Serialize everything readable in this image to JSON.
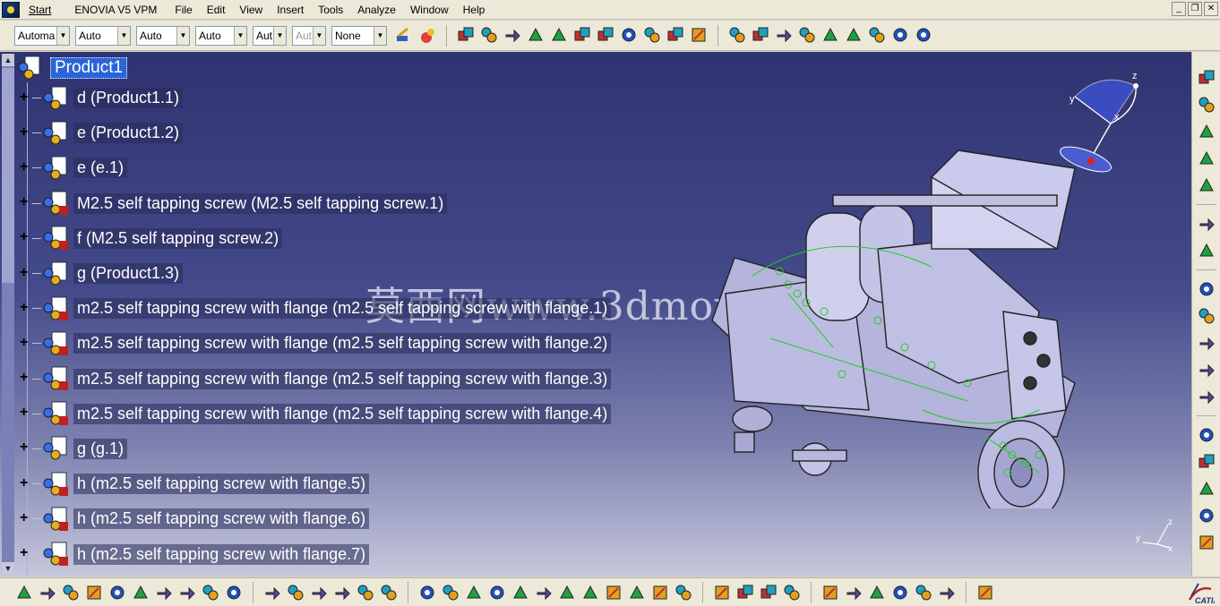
{
  "menubar": {
    "start": "Start",
    "enovia": "ENOVIA V5 VPM",
    "items": [
      "File",
      "Edit",
      "View",
      "Insert",
      "Tools",
      "Analyze",
      "Window",
      "Help"
    ]
  },
  "toolbar": {
    "combos": [
      {
        "value": "Automa",
        "disabled": false,
        "w": 60
      },
      {
        "value": "Auto",
        "disabled": false,
        "w": 62
      },
      {
        "value": "Auto",
        "disabled": false,
        "w": 60
      },
      {
        "value": "Auto",
        "disabled": false,
        "w": 58
      },
      {
        "value": "Aut",
        "disabled": false,
        "w": 38
      },
      {
        "value": "Aut",
        "disabled": true,
        "w": 38
      },
      {
        "value": "None",
        "disabled": false,
        "w": 62
      }
    ]
  },
  "tree": {
    "root": "Product1",
    "nodes": [
      "d (Product1.1)",
      "e (Product1.2)",
      "e (e.1)",
      "M2.5  self tapping screw (M2.5  self tapping screw.1)",
      "f (M2.5  self tapping screw.2)",
      "g (Product1.3)",
      "m2.5 self tapping screw with flange (m2.5 self tapping screw with flange.1)",
      "m2.5 self tapping screw with flange (m2.5 self tapping screw with flange.2)",
      "m2.5 self tapping screw with flange (m2.5 self tapping screw with flange.3)",
      "m2.5 self tapping screw with flange (m2.5 self tapping screw with flange.4)",
      "g (g.1)",
      "h (m2.5 self tapping screw with flange.5)",
      "h (m2.5 self tapping screw with flange.6)",
      "h (m2.5 self tapping screw with flange.7)"
    ]
  },
  "watermark": "莫西网www.3dmox.com",
  "compass": {
    "x": "x",
    "y": "y",
    "z": "z"
  },
  "axis": {
    "x": "x",
    "y": "y",
    "z": "z"
  },
  "brand": {
    "name": "CATIA"
  },
  "colors": {
    "selection": "#2a64d8",
    "constraint": "#22cc22",
    "model": "#c8c8ea"
  }
}
